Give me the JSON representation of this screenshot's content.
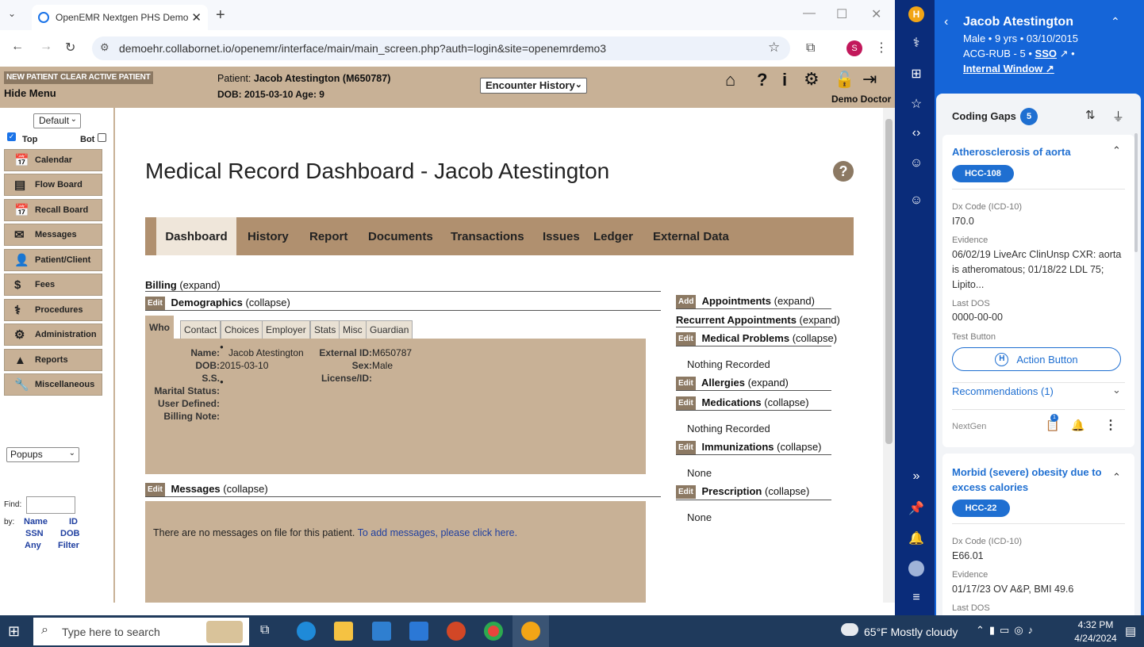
{
  "browser": {
    "tab_title": "OpenEMR Nextgen PHS Demo",
    "url": "demoehr.collabornet.io/openemr/interface/main/main_screen.php?auth=login&site=openemrdemo3",
    "profile_initial": "S"
  },
  "header": {
    "new_patient": "NEW PATIENT",
    "clear_active": "CLEAR ACTIVE PATIENT",
    "hide_menu": "Hide Menu",
    "patient_label": "Patient:",
    "patient_value": "Jacob Atestington (M650787)",
    "dob_line": "DOB: 2015-03-10 Age: 9",
    "encounter_select": "Encounter History",
    "user": "Demo Doctor"
  },
  "leftmenu": {
    "view_select": "Default",
    "top_label": "Top",
    "bot_label": "Bot",
    "items": [
      {
        "label": "Calendar",
        "icon": "📅"
      },
      {
        "label": "Flow Board",
        "icon": "▤"
      },
      {
        "label": "Recall Board",
        "icon": "📅"
      },
      {
        "label": "Messages",
        "icon": "✉"
      },
      {
        "label": "Patient/Client",
        "icon": "👤"
      },
      {
        "label": "Fees",
        "icon": "$"
      },
      {
        "label": "Procedures",
        "icon": "⚕"
      },
      {
        "label": "Administration",
        "icon": "⚙"
      },
      {
        "label": "Reports",
        "icon": "▲"
      },
      {
        "label": "Miscellaneous",
        "icon": "🔧"
      }
    ],
    "popups_select": "Popups",
    "find_label": "Find:",
    "by_label": "by:",
    "find_links": [
      "Name",
      "ID",
      "SSN",
      "DOB",
      "Any",
      "Filter"
    ]
  },
  "main": {
    "title": "Medical Record Dashboard - Jacob Atestington",
    "tabs": [
      "Dashboard",
      "History",
      "Report",
      "Documents",
      "Transactions",
      "Issues",
      "Ledger",
      "External Data"
    ],
    "billing": {
      "title": "Billing",
      "action": "(expand)"
    },
    "demographics": {
      "edit": "Edit",
      "title": "Demographics",
      "action": "(collapse)"
    },
    "demo_tabs": [
      "Who",
      "Contact",
      "Choices",
      "Employer",
      "Stats",
      "Misc",
      "Guardian"
    ],
    "fields": {
      "name_label": "Name:",
      "name_value": "Jacob  Atestington",
      "dob_label": "DOB:",
      "dob_value": "2015-03-10",
      "ss_label": "S.S.",
      "marital_label": "Marital Status:",
      "user_defined_label": "User Defined:",
      "billing_note_label": "Billing Note:",
      "ext_id_label": "External ID:",
      "ext_id_value": "M650787",
      "sex_label": "Sex:",
      "sex_value": "Male",
      "license_label": "License/ID:"
    },
    "messages": {
      "edit": "Edit",
      "title": "Messages",
      "action": "(collapse)",
      "empty_text": "There are no messages on file for this patient. ",
      "link": "To add messages, please click here."
    },
    "right": {
      "add": "Add",
      "appointments": "Appointments",
      "appointments_action": "(expand)",
      "recurrent": "Recurrent Appointments",
      "recurrent_action": "(expand)",
      "medical_problems": "Medical Problems",
      "medical_problems_action": "(collapse)",
      "medical_problems_value": "Nothing Recorded",
      "allergies": "Allergies",
      "allergies_action": "(expand)",
      "medications": "Medications",
      "medications_action": "(collapse)",
      "medications_value": "Nothing Recorded",
      "immunizations": "Immunizations",
      "immunizations_action": "(collapse)",
      "immunizations_value": "None",
      "prescription": "Prescription",
      "prescription_action": "(collapse)",
      "prescription_value": "None",
      "edit": "Edit"
    }
  },
  "sidepanel": {
    "patient_name": "Jacob Atestington",
    "demographics": "Male  •  9 yrs  •  03/10/2015",
    "acg": "ACG-RUB - 5 •",
    "sso": "SSO",
    "internal_window": "Internal Window",
    "coding_gaps_title": "Coding Gaps",
    "coding_gaps_count": "5",
    "gap1": {
      "title": "Atherosclerosis of aorta",
      "hcc": "HCC-108",
      "dx_label": "Dx Code (ICD-10)",
      "dx_value": "I70.0",
      "evidence_label": "Evidence",
      "evidence_value": "06/02/19 LiveArc ClinUnsp CXR: aorta is atheromatous; 01/18/22 LDL 75; Lipito...",
      "last_dos_label": "Last DOS",
      "last_dos_value": "0000-00-00",
      "test_button_label": "Test Button",
      "action_button": "Action Button",
      "recommendations": "Recommendations (1)",
      "source": "NextGen",
      "badge": "1"
    },
    "gap2": {
      "title": "Morbid (severe) obesity due to excess calories",
      "hcc": "HCC-22",
      "dx_label": "Dx Code (ICD-10)",
      "dx_value": "E66.01",
      "evidence_label": "Evidence",
      "evidence_value": "01/17/23 OV A&P, BMI 49.6",
      "last_dos_label": "Last DOS"
    }
  },
  "taskbar": {
    "search_placeholder": "Type here to search",
    "weather": "65°F  Mostly cloudy",
    "time": "4:32 PM",
    "date": "4/24/2024"
  }
}
